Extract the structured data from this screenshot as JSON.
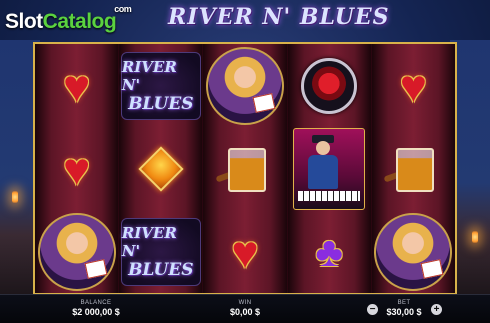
{
  "brand": {
    "part1": "Slot",
    "part2": "Catalog",
    "sup": "com"
  },
  "game": {
    "title": "RIVER N' BLUES"
  },
  "reels": [
    [
      {
        "symbol": "heart",
        "icon": "heart-icon"
      },
      {
        "symbol": "heart",
        "icon": "heart-icon"
      },
      {
        "symbol": "woman",
        "icon": "woman-with-cards-icon"
      }
    ],
    [
      {
        "symbol": "logo",
        "icon": "river-n-blues-logo-icon",
        "line1": "RIVER N'",
        "line2": "BLUES"
      },
      {
        "symbol": "diamond",
        "icon": "diamond-icon"
      },
      {
        "symbol": "logo",
        "icon": "river-n-blues-logo-icon",
        "line1": "RIVER N'",
        "line2": "BLUES"
      }
    ],
    [
      {
        "symbol": "woman",
        "icon": "woman-with-cards-icon"
      },
      {
        "symbol": "whiskey",
        "icon": "whiskey-glass-icon"
      },
      {
        "symbol": "heart",
        "icon": "heart-icon"
      }
    ],
    [
      {
        "symbol": "rose",
        "icon": "rose-icon"
      },
      {
        "symbol": "pianist",
        "icon": "pianist-icon"
      },
      {
        "symbol": "spade",
        "icon": "spade-icon"
      }
    ],
    [
      {
        "symbol": "heart",
        "icon": "heart-icon"
      },
      {
        "symbol": "whiskey",
        "icon": "whiskey-glass-icon"
      },
      {
        "symbol": "woman",
        "icon": "woman-with-cards-icon"
      }
    ]
  ],
  "bottom_bar": {
    "balance_label": "BALANCE",
    "balance_value": "$2 000,00 $",
    "win_label": "WIN",
    "win_value": "$0,00 $",
    "bet_label": "BET",
    "bet_value": "$30,00 $",
    "minus": "−",
    "plus": "+"
  },
  "colors": {
    "frame": "#d8b24a",
    "reel_bg": "#7c1e33",
    "heart": "#d81a28",
    "brand_green": "#5bd23f"
  }
}
